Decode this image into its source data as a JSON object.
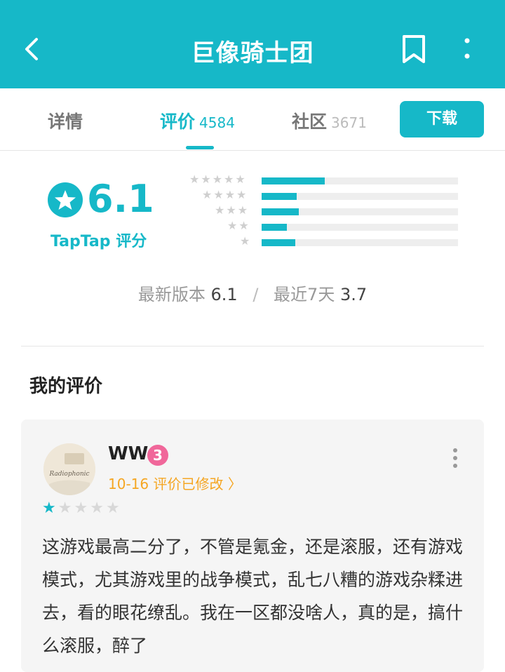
{
  "appbar": {
    "title": "巨像骑士团",
    "back_icon": "back-arrow-icon",
    "bookmark_icon": "bookmark-icon",
    "more_icon": "more-vertical-icon"
  },
  "tabs": [
    {
      "label": "详情",
      "count": ""
    },
    {
      "label": "评价",
      "count": "4584"
    },
    {
      "label": "社区",
      "count": "3671"
    }
  ],
  "download_label": "下载",
  "rating": {
    "score": "6.1",
    "label": "TapTap 评分",
    "distribution": [
      {
        "stars": 5,
        "fraction": 0.32
      },
      {
        "stars": 4,
        "fraction": 0.18
      },
      {
        "stars": 3,
        "fraction": 0.19
      },
      {
        "stars": 2,
        "fraction": 0.13
      },
      {
        "stars": 1,
        "fraction": 0.17
      }
    ],
    "latest_version_label": "最新版本",
    "latest_version_score": "6.1",
    "recent_label": "最近7天",
    "recent_score": "3.7"
  },
  "my_review": {
    "heading": "我的评价",
    "username": "WW",
    "level": "3",
    "meta": "10-16 评价已修改 〉",
    "stars": 1,
    "max_stars": 5,
    "body": "这游戏最高二分了，不管是氪金，还是滚服，还有游戏模式，尤其游戏里的战争模式，乱七八糟的游戏杂糅进去，看的眼花缭乱。我在一区都没啥人，真的是，搞什么滚服，醉了",
    "avatar_text": "Radiophonic"
  },
  "colors": {
    "accent": "#16b8c8",
    "meta_orange": "#f5a623",
    "badge_pink": "#f0679a"
  }
}
